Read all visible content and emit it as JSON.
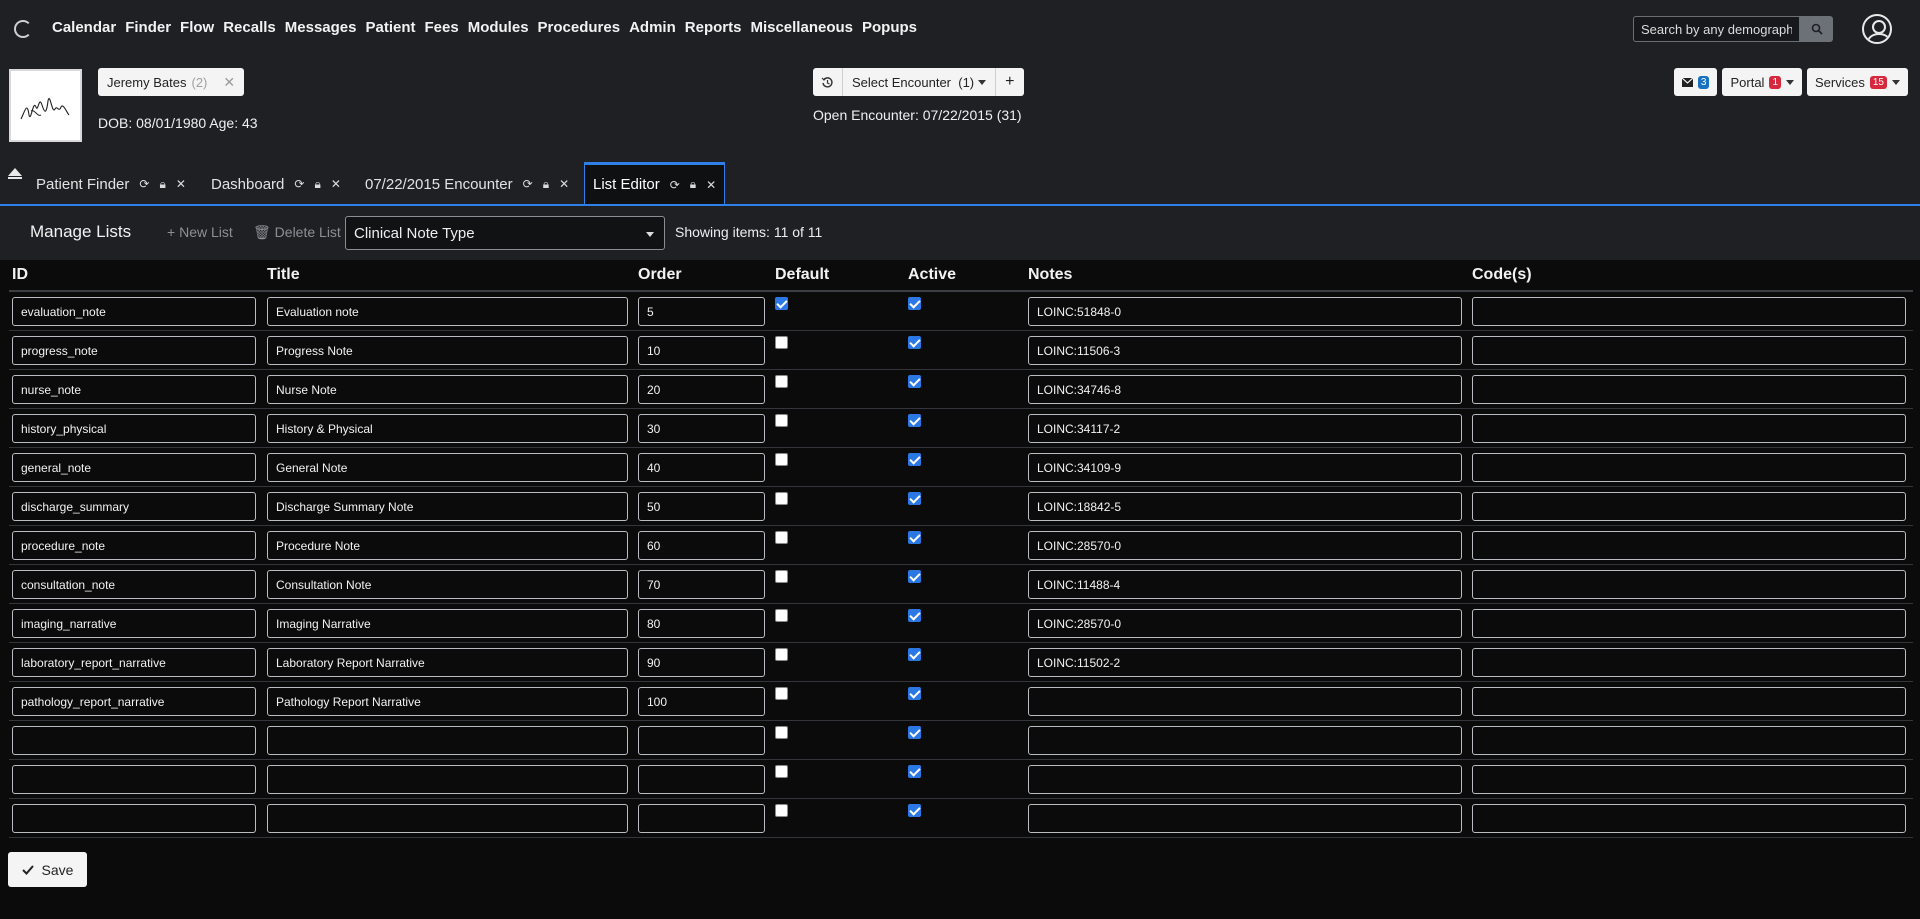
{
  "nav": {
    "menu": [
      "Calendar",
      "Finder",
      "Flow",
      "Recalls",
      "Messages",
      "Patient",
      "Fees",
      "Modules",
      "Procedures",
      "Admin",
      "Reports",
      "Miscellaneous",
      "Popups"
    ],
    "search_placeholder": "Search by any demographics"
  },
  "patient": {
    "name": "Jeremy Bates",
    "count": "(2)",
    "dob_line": "DOB: 08/01/1980 Age: 43"
  },
  "encounter": {
    "select_label": "Select Encounter",
    "select_count": "(1)",
    "open_line": "Open Encounter: 07/22/2015 (31)"
  },
  "header_buttons": {
    "messages_badge": "3",
    "portal_label": "Portal",
    "portal_badge": "1",
    "services_label": "Services",
    "services_badge": "15"
  },
  "tabs": [
    {
      "label": "Patient Finder"
    },
    {
      "label": "Dashboard"
    },
    {
      "label": "07/22/2015 Encounter"
    },
    {
      "label": "List Editor"
    }
  ],
  "toolbar": {
    "title": "Manage Lists",
    "new_list": "New List",
    "delete_list": "Delete List",
    "selected_list": "Clinical Note Type",
    "showing": "Showing items: 11 of 11"
  },
  "table": {
    "headers": {
      "id": "ID",
      "title": "Title",
      "order": "Order",
      "default": "Default",
      "active": "Active",
      "notes": "Notes",
      "codes": "Code(s)"
    },
    "rows": [
      {
        "id": "evaluation_note",
        "title": "Evaluation note",
        "order": "5",
        "default": true,
        "active": true,
        "notes": "LOINC:51848-0",
        "codes": ""
      },
      {
        "id": "progress_note",
        "title": "Progress Note",
        "order": "10",
        "default": false,
        "active": true,
        "notes": "LOINC:11506-3",
        "codes": ""
      },
      {
        "id": "nurse_note",
        "title": "Nurse Note",
        "order": "20",
        "default": false,
        "active": true,
        "notes": "LOINC:34746-8",
        "codes": ""
      },
      {
        "id": "history_physical",
        "title": "History & Physical",
        "order": "30",
        "default": false,
        "active": true,
        "notes": "LOINC:34117-2",
        "codes": ""
      },
      {
        "id": "general_note",
        "title": "General Note",
        "order": "40",
        "default": false,
        "active": true,
        "notes": "LOINC:34109-9",
        "codes": ""
      },
      {
        "id": "discharge_summary",
        "title": "Discharge Summary Note",
        "order": "50",
        "default": false,
        "active": true,
        "notes": "LOINC:18842-5",
        "codes": ""
      },
      {
        "id": "procedure_note",
        "title": "Procedure Note",
        "order": "60",
        "default": false,
        "active": true,
        "notes": "LOINC:28570-0",
        "codes": ""
      },
      {
        "id": "consultation_note",
        "title": "Consultation Note",
        "order": "70",
        "default": false,
        "active": true,
        "notes": "LOINC:11488-4",
        "codes": ""
      },
      {
        "id": "imaging_narrative",
        "title": "Imaging Narrative",
        "order": "80",
        "default": false,
        "active": true,
        "notes": "LOINC:28570-0",
        "codes": ""
      },
      {
        "id": "laboratory_report_narrative",
        "title": "Laboratory Report Narrative",
        "order": "90",
        "default": false,
        "active": true,
        "notes": "LOINC:11502-2",
        "codes": ""
      },
      {
        "id": "pathology_report_narrative",
        "title": "Pathology Report Narrative",
        "order": "100",
        "default": false,
        "active": true,
        "notes": "",
        "codes": ""
      },
      {
        "id": "",
        "title": "",
        "order": "",
        "default": false,
        "active": true,
        "notes": "",
        "codes": ""
      },
      {
        "id": "",
        "title": "",
        "order": "",
        "default": false,
        "active": true,
        "notes": "",
        "codes": ""
      },
      {
        "id": "",
        "title": "",
        "order": "",
        "default": false,
        "active": true,
        "notes": "",
        "codes": ""
      }
    ]
  },
  "save_label": "Save"
}
